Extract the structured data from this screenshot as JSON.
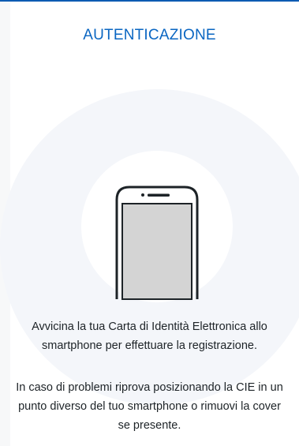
{
  "header": {
    "title": "AUTENTICAZIONE"
  },
  "illustration": {
    "icon": "smartphone-icon",
    "halo_color": "#f4f6fa",
    "inner_circle_color": "#ffffff",
    "phone_outline_color": "#1d2327",
    "phone_screen_color": "#d4d4d4"
  },
  "instructions": {
    "primary": "Avvicina la tua Carta di Identità Elettronica allo smartphone per effettuare la registrazione.",
    "secondary": "In caso di problemi riprova posizionando la CIE in un punto diverso del tuo smartphone o rimuovi la cover se presente."
  },
  "colors": {
    "accent": "#0a66c2",
    "top_bar": "#0c5bb2"
  }
}
